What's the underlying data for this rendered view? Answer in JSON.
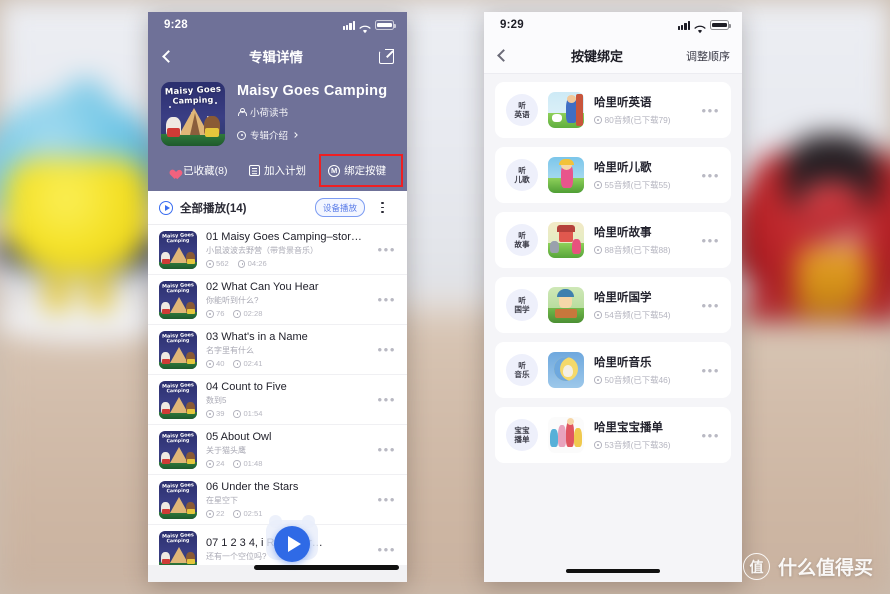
{
  "watermark": {
    "text": "什么值得买",
    "logo_glyph": "值"
  },
  "left_phone": {
    "status": {
      "time": "9:28"
    },
    "nav": {
      "back_icon": "chevron-left-icon",
      "title": "专辑详情",
      "share_icon": "share-icon"
    },
    "album": {
      "cover_line1": "Maisy Goes",
      "cover_line2": "Camping",
      "title": "Maisy Goes Camping",
      "author": "小荷读书",
      "intro": "专辑介绍"
    },
    "actions": [
      {
        "label": "已收藏(8)",
        "icon": "heart-icon",
        "highlighted": false
      },
      {
        "label": "加入计划",
        "icon": "plan-icon",
        "highlighted": false
      },
      {
        "label": "绑定按键",
        "icon": "m-circle-icon",
        "highlighted": true
      }
    ],
    "playbar": {
      "play_all": "全部播放(14)",
      "device_button": "设备播放",
      "sort_icon": "list-sort-icon"
    },
    "tracks": [
      {
        "title": "01 Maisy Goes Camping–story…",
        "sub": "小鼠波波去野营（带背景音乐）",
        "plays": "562",
        "duration": "04:26"
      },
      {
        "title": "02 What Can You Hear",
        "sub": "你能听到什么?",
        "plays": "76",
        "duration": "02:28"
      },
      {
        "title": "03 What's in a Name",
        "sub": "名字里有什么",
        "plays": "40",
        "duration": "02:41"
      },
      {
        "title": "04 Count to Five",
        "sub": "数到5",
        "plays": "39",
        "duration": "01:54"
      },
      {
        "title": "05 About Owl",
        "sub": "关于猫头鹰",
        "plays": "24",
        "duration": "01:48"
      },
      {
        "title": "06 Under the Stars",
        "sub": "在星空下",
        "plays": "22",
        "duration": "02:51"
      },
      {
        "title": "07 1 2 3 4, i          Room for…",
        "sub": "还有一个空位吗?",
        "plays": "",
        "duration": ""
      }
    ],
    "mini_player": {
      "icon": "play-icon"
    },
    "row_menu_glyph": "•••"
  },
  "right_phone": {
    "status": {
      "time": "9:29"
    },
    "nav": {
      "back_icon": "chevron-left-icon",
      "title": "按键绑定",
      "action": "调整顺序"
    },
    "bindings": [
      {
        "key_line1": "听",
        "key_line2": "英语",
        "title": "哈里听英语",
        "meta": "80音频(已下载79)",
        "art": "english"
      },
      {
        "key_line1": "听",
        "key_line2": "儿歌",
        "title": "哈里听儿歌",
        "meta": "55音频(已下载55)",
        "art": "songs"
      },
      {
        "key_line1": "听",
        "key_line2": "故事",
        "title": "哈里听故事",
        "meta": "88音频(已下载88)",
        "art": "stories"
      },
      {
        "key_line1": "听",
        "key_line2": "国学",
        "title": "哈里听国学",
        "meta": "54音频(已下载54)",
        "art": "classics"
      },
      {
        "key_line1": "听",
        "key_line2": "音乐",
        "title": "哈里听音乐",
        "meta": "50音频(已下载46)",
        "art": "music"
      },
      {
        "key_line1": "宝宝",
        "key_line2": "播单",
        "title": "哈里宝宝播单",
        "meta": "53音频(已下载36)",
        "art": "playlist"
      }
    ],
    "row_menu_glyph": "•••"
  },
  "colors": {
    "left_header_purple": "#6f7198",
    "accent_blue": "#2f6ae6",
    "highlight_red": "#ef1f22",
    "heart_pink": "#f2627e",
    "key_badge_bg": "#eef0fb"
  }
}
